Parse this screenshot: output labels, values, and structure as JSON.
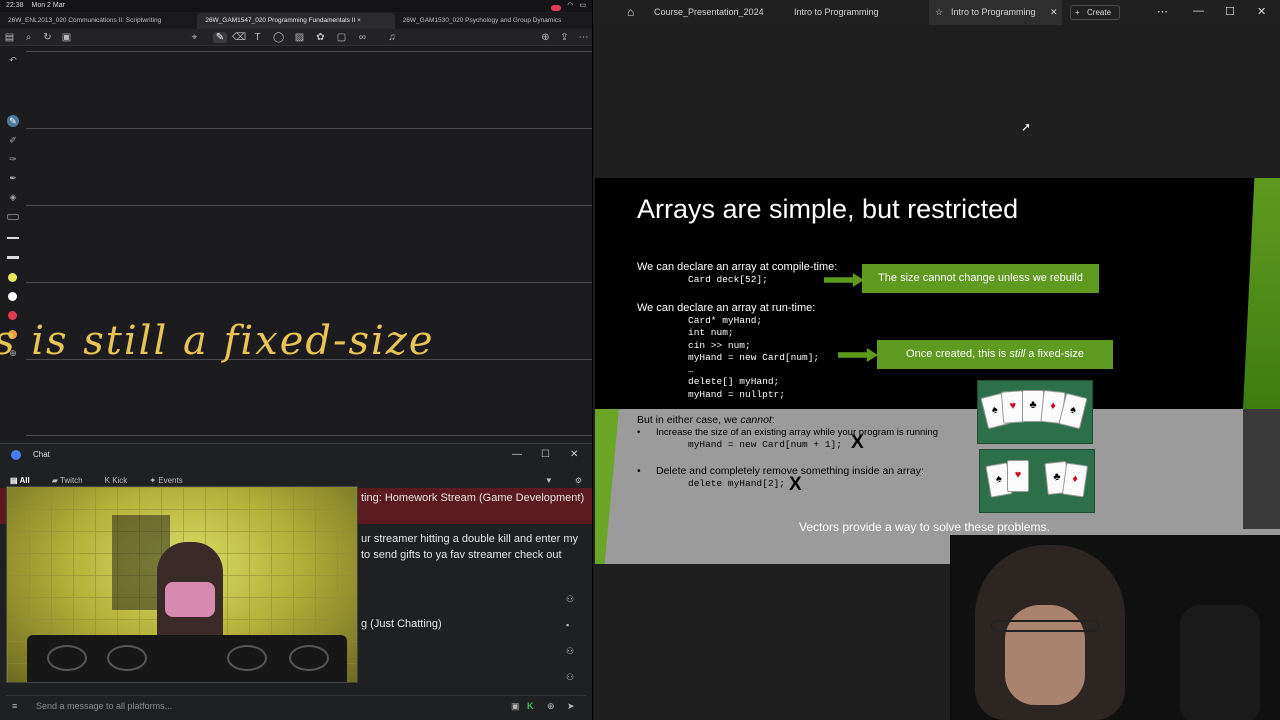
{
  "left": {
    "status": {
      "time": "22:38",
      "date": "Mon 2 Mar"
    },
    "tabs": [
      "26W_ENL2013_020 Communications II: Scriptwriting",
      "26W_GAM1547_020 Programming Fundamentals II",
      "26W_GAM1530_020 Psychology and Group Dynamics"
    ],
    "handwriting": "s is still a fixed-size"
  },
  "chat": {
    "title": "Chat",
    "tabs": [
      "All",
      "Twitch",
      "Kick",
      "Events"
    ],
    "lines": [
      "ting: Homework Stream (Game Development)",
      "ur streamer hitting a double kill and enter my",
      " to send gifts to ya fav streamer check out",
      "g (Just Chatting)"
    ],
    "input_placeholder": "Send a message to all platforms..."
  },
  "right": {
    "tabs": [
      "Course_Presentation_2024",
      "Intro to Programming",
      "Intro to Programming"
    ],
    "create_label": "Create"
  },
  "slide": {
    "title": "Arrays are simple, but restricted",
    "compile_label": "We can declare an array at compile-time:",
    "compile_code": "Card deck[52];",
    "callout1": "The size cannot change unless we rebuild",
    "runtime_label": "We can declare an array at run-time:",
    "runtime_code": "Card* myHand;\nint num;\ncin >> num;\nmyHand = new Card[num];\n…\ndelete[] myHand;\nmyHand = nullptr;",
    "callout2_pre": "Once created, this is ",
    "callout2_em": "still",
    "callout2_post": " a fixed-size",
    "either_pre": "But in either case, we ",
    "either_em": "cannot",
    "either_post": ":",
    "bullet1": "Increase the size of an existing array while your program is running",
    "bullet1_code": "myHand = new Card[num + 1];",
    "bullet2": "Delete and completely remove something inside an array:",
    "bullet2_code": "delete myHand[2];",
    "mark": "X",
    "footer": "Vectors provide a way to solve these problems."
  }
}
